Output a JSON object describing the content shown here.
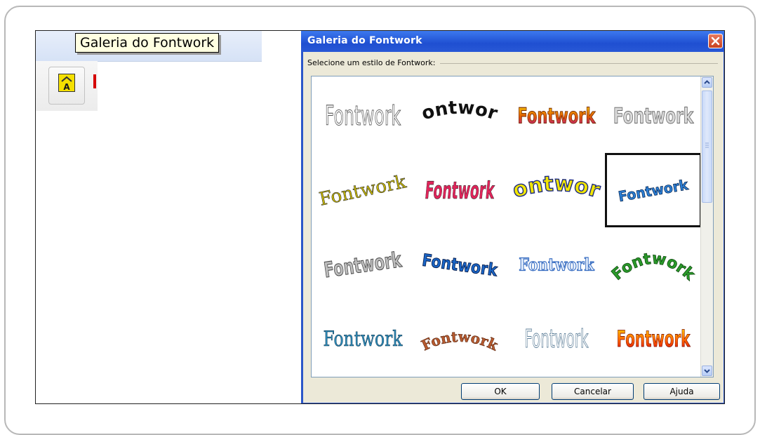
{
  "tooltip": {
    "text": "Galeria do Fontwork"
  },
  "toolbar": {
    "fontwork_button_icon": "fontwork-gallery-icon"
  },
  "dialog": {
    "title": "Galeria do Fontwork",
    "group_label": "Selecione um estilo de Fontwork:",
    "selected_index": 7,
    "items": [
      "Fontwork",
      "Fontwork",
      "Fontwork",
      "Fontwork",
      "Fontwork",
      "Fontwork",
      "Fontwork",
      "Fontwork",
      "Fontwork",
      "Fontwork",
      "Fontwork",
      "Fontwork",
      "Fontwork",
      "Fontwork",
      "Fontwork",
      "Fontwork"
    ],
    "buttons": {
      "ok": "OK",
      "cancel": "Cancelar",
      "help": "Ajuda"
    }
  },
  "colors": {
    "title_bar": "#2b56c9",
    "dialog_face": "#ece9d8",
    "tooltip_bg": "#ffffe1"
  }
}
